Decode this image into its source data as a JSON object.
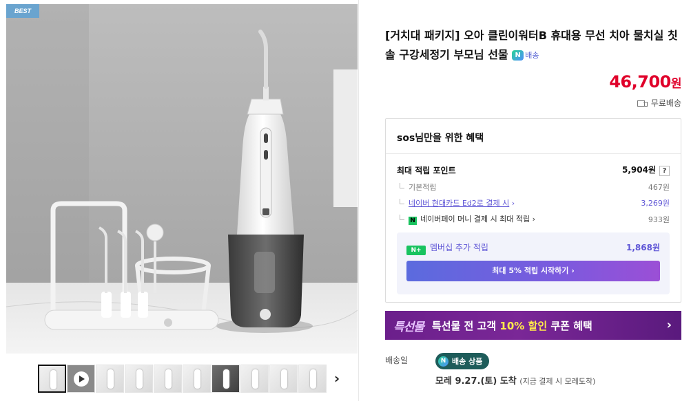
{
  "gallery": {
    "badge": "BEST",
    "product_logo": "oo",
    "next_arrow": "›",
    "thumb_count": 10
  },
  "product": {
    "title": "[거치대 패키지] 오아 클린이워터B 휴대용 무선 치아 물치실 칫솔 구강세정기 부모님 선물",
    "npay_badge": "배송",
    "price_value": "46,700",
    "price_unit": "원",
    "shipping": "무료배송"
  },
  "benefit": {
    "heading": "sos님만을 위한 혜택",
    "max_points_label": "최대 적립 포인트",
    "max_points_value": "5,904원",
    "help_icon": "?",
    "basic_label": "기본적립",
    "basic_value": "467원",
    "card_label": "네이버 현대카드 Ed2로 결제 시",
    "card_value": "3,269원",
    "npay_money_label": "네이버페이 머니 결제 시 최대 적립",
    "npay_money_value": "933원",
    "membership_badge": "N+",
    "membership_label": "멤버십 추가 적립",
    "membership_value": "1,868원",
    "membership_button": "최대 5% 적립 시작하기"
  },
  "coupon": {
    "logo": "특선물",
    "text_prefix": "특선물 전 고객 ",
    "text_highlight": "10% 할인",
    "text_suffix": " 쿠폰 혜택"
  },
  "delivery": {
    "label": "배송일",
    "pill": "배송 상품",
    "arrival": "모레 9.27.(토) 도착",
    "note": "(지금 결제 시 모레도착)"
  },
  "colors": {
    "price": "#e0002a",
    "link": "#5f56d6",
    "npay_green": "#19c35f",
    "coupon_bg": "#6b1f8b",
    "pill_bg": "#1e5c5a"
  }
}
